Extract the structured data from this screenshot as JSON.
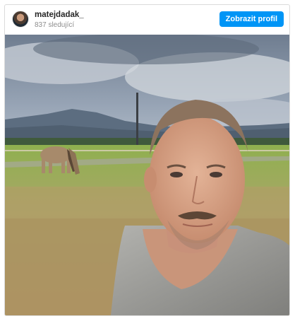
{
  "post": {
    "username": "matejdadak_",
    "followers": "837 sledující",
    "profile_button": "Zobrazit profil",
    "avatar_icon": "avatar-photo",
    "image": {
      "description_icon": "selfie-with-grazing-horse",
      "colors": {
        "sky": "#8a97a8",
        "clouds": "#c9d0d9",
        "mountain": "#5b6e82",
        "grass": "#8fb04f",
        "dry_grass": "#b89a66",
        "skin": "#d6a487",
        "tank_top": "#9a9a97",
        "horse": "#a88a6a"
      }
    },
    "accent_color": "#0095f6"
  }
}
